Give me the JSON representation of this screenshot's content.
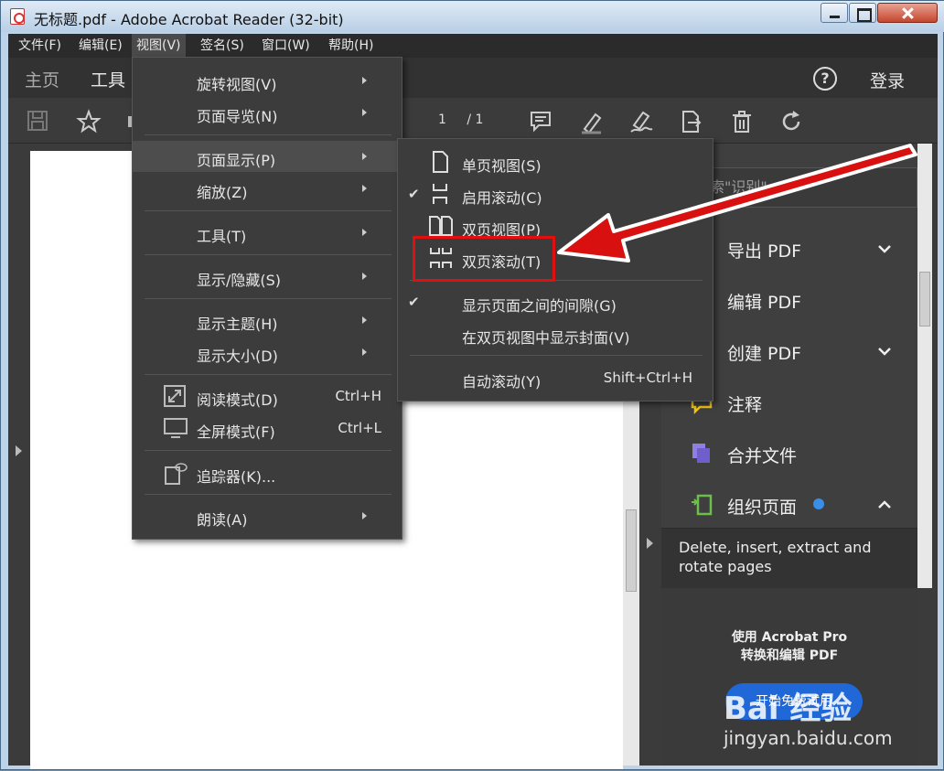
{
  "window": {
    "title": "无标题.pdf - Adobe Acrobat Reader (32-bit)"
  },
  "menubar": {
    "items": [
      "文件(F)",
      "编辑(E)",
      "视图(V)",
      "签名(S)",
      "窗口(W)",
      "帮助(H)"
    ]
  },
  "tabs": {
    "home": "主页",
    "tools": "工具",
    "help": "?",
    "login": "登录"
  },
  "toolbar": {
    "page_current": "1",
    "page_total": "/ 1"
  },
  "view_menu": {
    "items": [
      {
        "label": "旋转视图(V)",
        "has_submenu": true
      },
      {
        "label": "页面导览(N)",
        "has_submenu": true
      },
      {
        "label": "页面显示(P)",
        "has_submenu": true,
        "highlighted": true
      },
      {
        "label": "缩放(Z)",
        "has_submenu": true
      },
      {
        "label": "工具(T)",
        "has_submenu": true
      },
      {
        "label": "显示/隐藏(S)",
        "has_submenu": true
      },
      {
        "label": "显示主题(H)",
        "has_submenu": true
      },
      {
        "label": "显示大小(D)",
        "has_submenu": true
      },
      {
        "label": "阅读模式(D)",
        "shortcut": "Ctrl+H"
      },
      {
        "label": "全屏模式(F)",
        "shortcut": "Ctrl+L"
      },
      {
        "label": "追踪器(K)..."
      },
      {
        "label": "朗读(A)",
        "has_submenu": true
      }
    ]
  },
  "page_display_submenu": {
    "items": [
      {
        "label": "单页视图(S)",
        "icon": "single-page-icon"
      },
      {
        "label": "启用滚动(C)",
        "icon": "scroll-icon",
        "checked": true
      },
      {
        "label": "双页视图(P)",
        "icon": "two-page-icon"
      },
      {
        "label": "双页滚动(T)",
        "icon": "two-page-scroll-icon",
        "boxed": true
      },
      {
        "label": "显示页面之间的间隙(G)",
        "checked": true
      },
      {
        "label": "在双页视图中显示封面(V)"
      },
      {
        "label": "自动滚动(Y)",
        "shortcut": "Shift+Ctrl+H"
      }
    ]
  },
  "right_panel": {
    "search_placeholder": "搜索\"识别\"",
    "tools": [
      {
        "label": "导出 PDF",
        "icon": "export-pdf-icon",
        "chevron": "⌄",
        "color": "#d9534f"
      },
      {
        "label": "编辑 PDF",
        "icon": "edit-pdf-icon",
        "color": "#e0407b"
      },
      {
        "label": "创建 PDF",
        "icon": "create-pdf-icon",
        "chevron": "⌄",
        "color": "#d9534f"
      },
      {
        "label": "注释",
        "icon": "comment-icon",
        "color": "#f0c419"
      },
      {
        "label": "合并文件",
        "icon": "combine-files-icon",
        "color": "#8e7fe0"
      },
      {
        "label": "组织页面",
        "icon": "organize-pages-icon",
        "chevron": "⌃",
        "color": "#6cc04a"
      }
    ],
    "description": "Delete, insert, extract and rotate pages",
    "promo": "使用 Acrobat Pro\n转换和编辑 PDF",
    "trial_button": "开始免费试用"
  },
  "watermark": {
    "logo": "Bai 经验",
    "site": "jingyan.baidu.com"
  },
  "colors": {
    "highlight_box": "#e01010",
    "arrow": "#d81010",
    "trial_button": "#2068d8"
  }
}
